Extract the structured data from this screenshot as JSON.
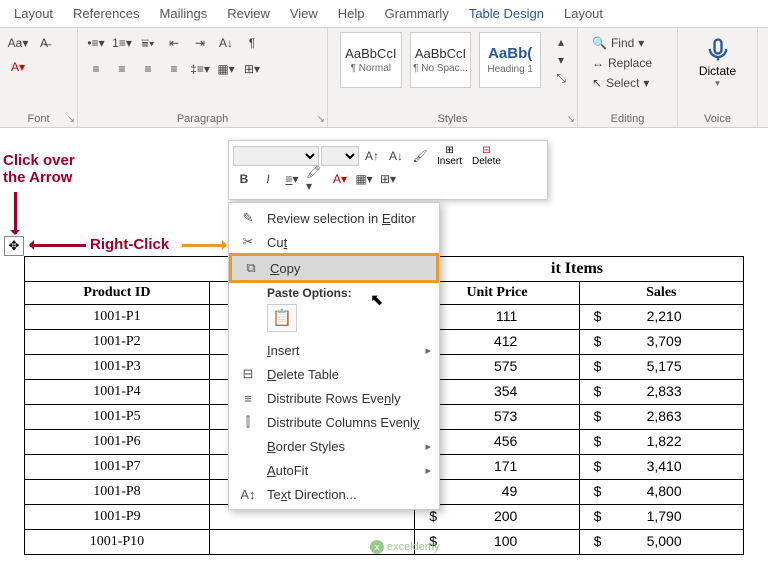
{
  "tabs": [
    "Layout",
    "References",
    "Mailings",
    "Review",
    "View",
    "Help",
    "Grammarly"
  ],
  "context_tabs": [
    "Table Design",
    "Layout"
  ],
  "ribbon": {
    "font_group": "Font",
    "paragraph_group": "Paragraph",
    "styles_group": "Styles",
    "editing_group": "Editing",
    "voice_group": "Voice",
    "styles": [
      {
        "preview": "AaBbCcI",
        "name": "¶ Normal"
      },
      {
        "preview": "AaBbCcI",
        "name": "¶ No Spac..."
      },
      {
        "preview": "AaBb(",
        "name": "Heading 1"
      }
    ],
    "editing": {
      "find": "Find",
      "replace": "Replace",
      "select": "Select"
    },
    "dictate": "Dictate"
  },
  "annotations": {
    "click_over": "Click over the Arrow",
    "right_click": "Right-Click"
  },
  "mini_toolbar": {
    "insert": "Insert",
    "delete": "Delete"
  },
  "context_menu": {
    "review": "Review selection in Editor",
    "cut": "Cut",
    "copy": "Copy",
    "paste_options": "Paste Options:",
    "insert": "Insert",
    "delete_table": "Delete Table",
    "dist_rows": "Distribute Rows Evenly",
    "dist_cols": "Distribute Columns Evenly",
    "border_styles": "Border Styles",
    "autofit": "AutoFit",
    "text_direction": "Text Direction..."
  },
  "table": {
    "title": "it Items",
    "headers": [
      "Product ID",
      "",
      "Unit Price",
      "Sales"
    ],
    "rows": [
      {
        "id": "1001-P1",
        "price": "111",
        "sales": "2,210"
      },
      {
        "id": "1001-P2",
        "price": "412",
        "sales": "3,709"
      },
      {
        "id": "1001-P3",
        "price": "575",
        "sales": "5,175"
      },
      {
        "id": "1001-P4",
        "price": "354",
        "sales": "2,833"
      },
      {
        "id": "1001-P5",
        "price": "573",
        "sales": "2,863"
      },
      {
        "id": "1001-P6",
        "price": "456",
        "sales": "1,822"
      },
      {
        "id": "1001-P7",
        "price": "171",
        "sales": "3,410"
      },
      {
        "id": "1001-P8",
        "price": "49",
        "sales": "4,800"
      },
      {
        "id": "1001-P9",
        "price": "200",
        "sales": "1,790"
      },
      {
        "id": "1001-P10",
        "price": "100",
        "sales": "5,000"
      }
    ]
  },
  "watermark": "exceldemy"
}
